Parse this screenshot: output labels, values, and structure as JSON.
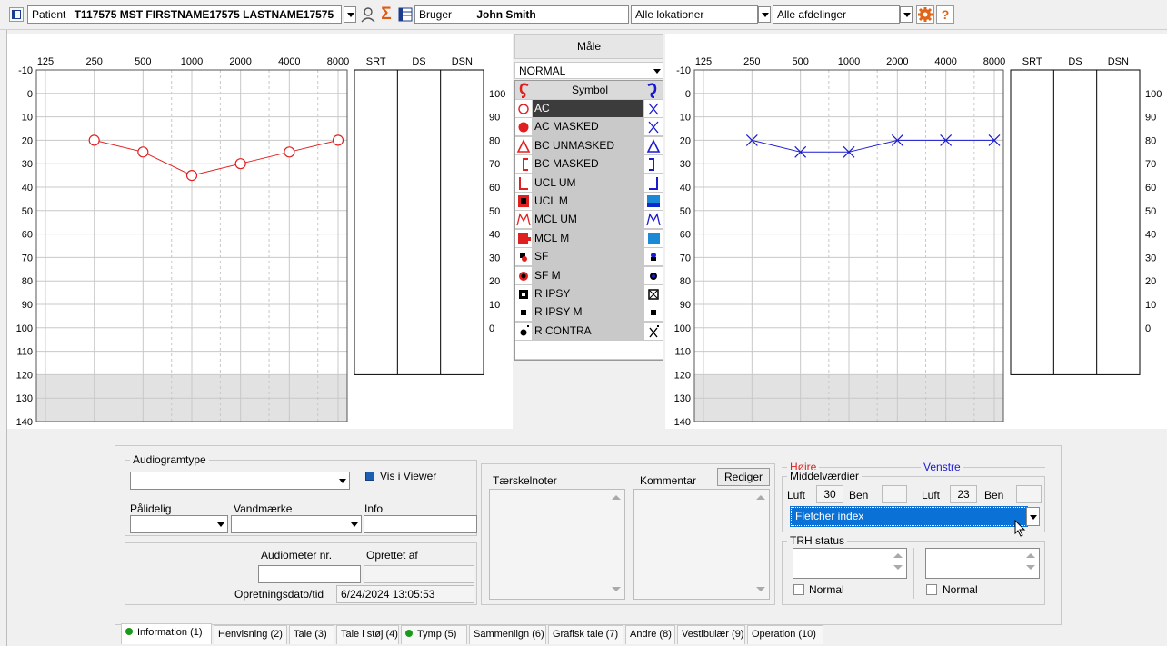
{
  "topbar": {
    "patient_label": "Patient",
    "patient_name": "T117575 MST FIRSTNAME17575 LASTNAME17575",
    "user_label": "Bruger",
    "user_name": "John Smith",
    "location": "Alle lokationer",
    "department": "Alle afdelinger",
    "help": "?"
  },
  "audiogram": {
    "freq_labels": [
      "125",
      "250",
      "500",
      "1000",
      "2000",
      "4000",
      "8000"
    ],
    "speech_headers": [
      "SRT",
      "DS",
      "DSN"
    ],
    "db_labels": [
      "-10",
      "0",
      "10",
      "20",
      "30",
      "40",
      "50",
      "60",
      "70",
      "80",
      "90",
      "100",
      "110",
      "120",
      "130",
      "140"
    ],
    "pct_labels": [
      "100",
      "90",
      "80",
      "70",
      "60",
      "50",
      "40",
      "30",
      "20",
      "10",
      "0"
    ]
  },
  "chart_data": [
    {
      "type": "line",
      "name": "Right ear (Højre) AC",
      "color": "#e02020",
      "x": [
        250,
        500,
        1000,
        2000,
        4000,
        8000
      ],
      "y": [
        20,
        25,
        35,
        30,
        25,
        20
      ],
      "xscale": "log",
      "ylim": [
        140,
        -10
      ]
    },
    {
      "type": "line",
      "name": "Left ear (Venstre) AC",
      "color": "#1a1ad0",
      "x": [
        250,
        500,
        1000,
        2000,
        4000,
        8000
      ],
      "y": [
        20,
        25,
        25,
        20,
        20,
        20
      ],
      "xscale": "log",
      "ylim": [
        140,
        -10
      ]
    }
  ],
  "legend": {
    "title": "Måle",
    "mode": "NORMAL",
    "header": "Symbol",
    "items": [
      "AC",
      "AC MASKED",
      "BC UNMASKED",
      "BC MASKED",
      "UCL UM",
      "UCL M",
      "MCL UM",
      "MCL M",
      "SF",
      "SF M",
      "R IPSY",
      "R IPSY M",
      "R CONTRA"
    ]
  },
  "form": {
    "audiogramtype_label": "Audiogramtype",
    "vis_i_viewer": "Vis i Viewer",
    "paalidelig_label": "Pålidelig",
    "vandmaerke_label": "Vandmærke",
    "info_label": "Info",
    "audiometer_label": "Audiometer nr.",
    "oprettet_label": "Oprettet af",
    "dato_label": "Opretningsdato/tid",
    "dato_value": "6/24/2024 13:05:53",
    "taerskel_label": "Tærskelnoter",
    "kommentar_label": "Kommentar",
    "rediger": "Rediger",
    "hojre": "Højre",
    "venstre": "Venstre",
    "middel_label": "Middelværdier",
    "luft": "Luft",
    "ben": "Ben",
    "right_luft": "30",
    "left_luft": "23",
    "index_value": "Fletcher index",
    "trh_label": "TRH status",
    "normal": "Normal"
  },
  "tabs": [
    "Information (1)",
    "Henvisning (2)",
    "Tale (3)",
    "Tale i støj (4)",
    "Tymp (5)",
    "Sammenlign (6)",
    "Grafisk tale (7)",
    "Andre (8)",
    "Vestibulær (9)",
    "Operation (10)"
  ]
}
